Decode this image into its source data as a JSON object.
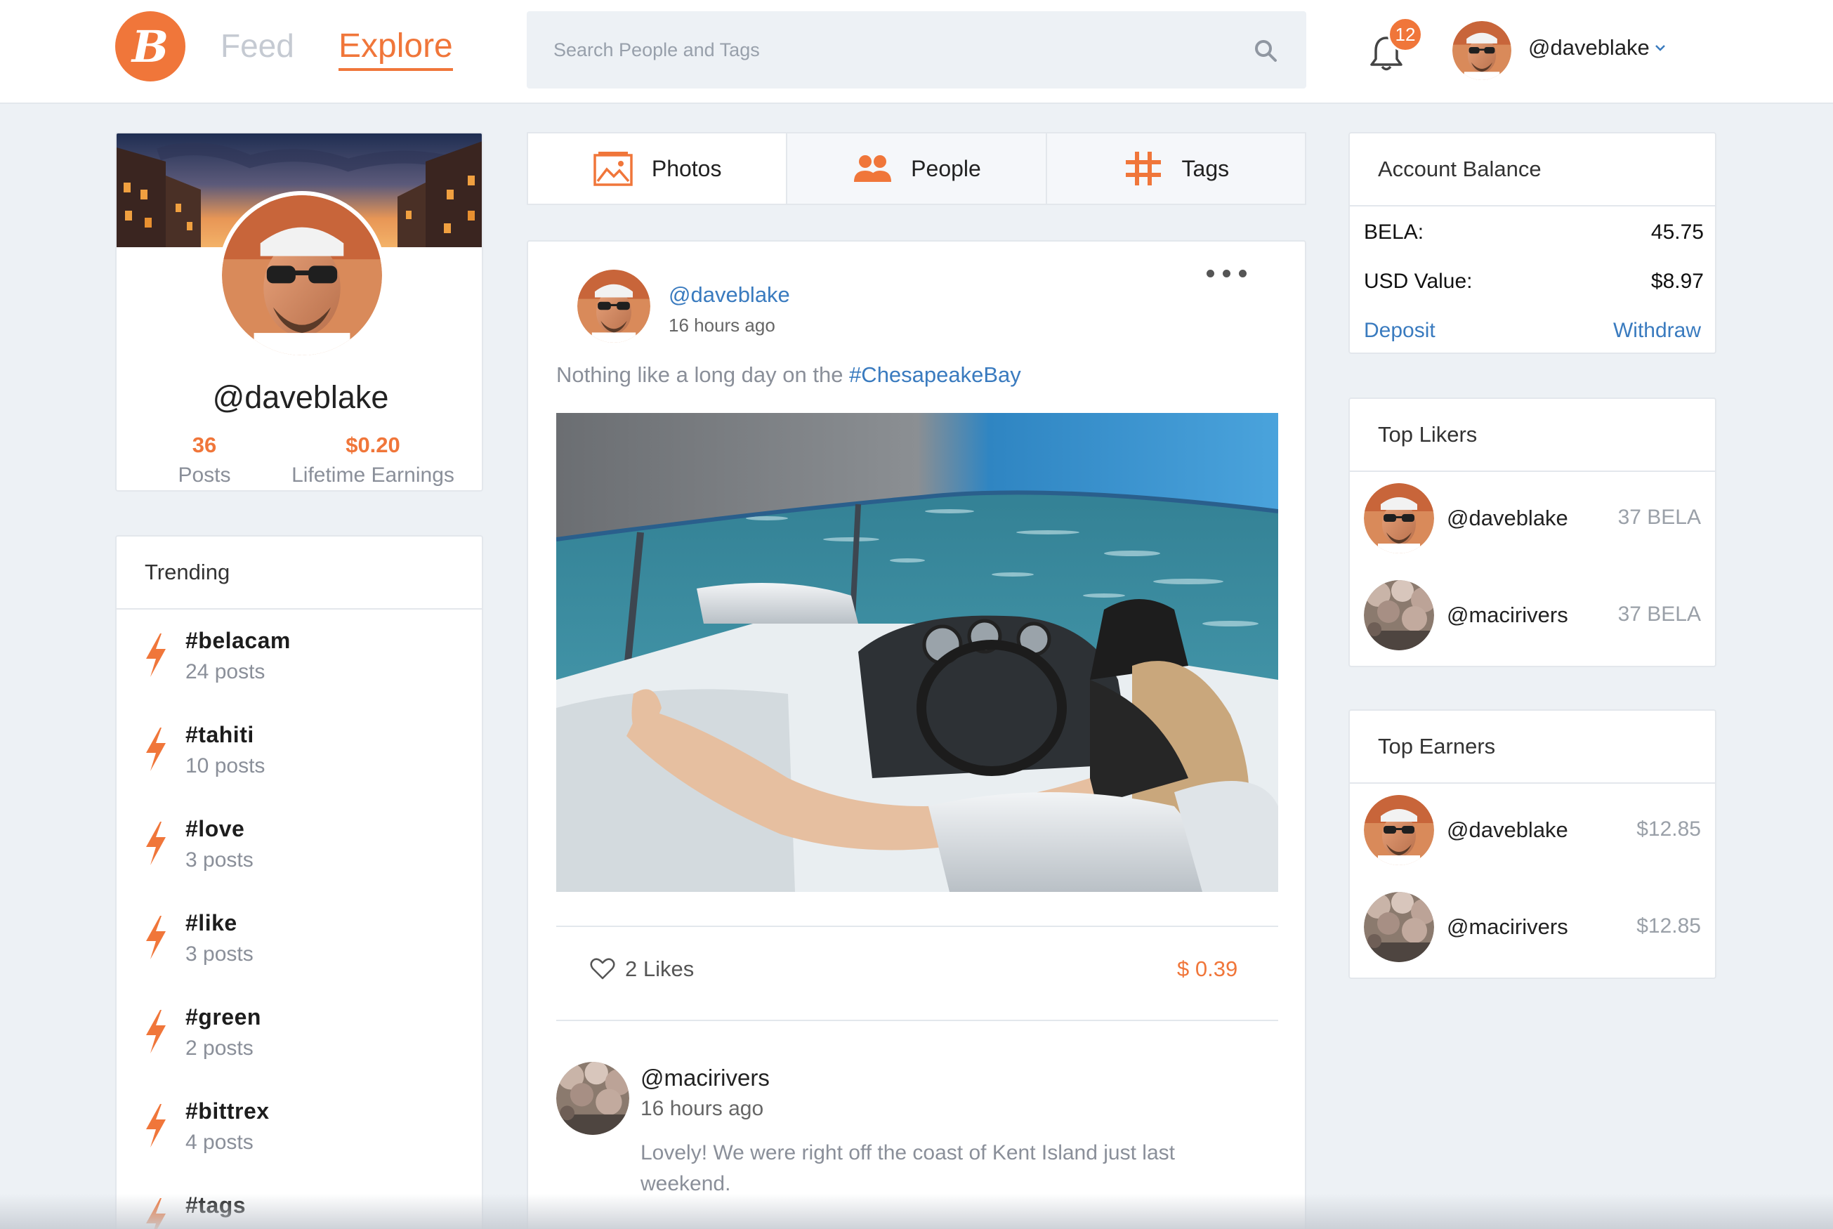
{
  "header": {
    "logo_letter": "B",
    "nav_feed": "Feed",
    "nav_explore": "Explore",
    "search_placeholder": "Search People and Tags",
    "notification_count": "12",
    "username": "@daveblake"
  },
  "profile": {
    "username": "@daveblake",
    "posts_count": "36",
    "posts_label": "Posts",
    "earnings": "$0.20",
    "earnings_label": "Lifetime Earnings"
  },
  "trending": {
    "title": "Trending",
    "items": [
      {
        "tag": "#belacam",
        "count": "24 posts"
      },
      {
        "tag": "#tahiti",
        "count": "10 posts"
      },
      {
        "tag": "#love",
        "count": "3 posts"
      },
      {
        "tag": "#like",
        "count": "3 posts"
      },
      {
        "tag": "#green",
        "count": "2 posts"
      },
      {
        "tag": "#bittrex",
        "count": "4 posts"
      },
      {
        "tag": "#tags",
        "count": ""
      }
    ]
  },
  "tabs": [
    {
      "label": "Photos"
    },
    {
      "label": "People"
    },
    {
      "label": "Tags"
    }
  ],
  "post": {
    "username": "@daveblake",
    "time": "16 hours ago",
    "caption_text": "Nothing like a long day on the ",
    "caption_tag": "#ChesapeakeBay",
    "likes": "2 Likes",
    "earnings": "$ 0.39",
    "comment": {
      "username": "@macirivers",
      "time": "16 hours ago",
      "text": "Lovely! We were right off the coast of Kent Island just last weekend."
    }
  },
  "balance": {
    "title": "Account Balance",
    "bela_label": "BELA:",
    "bela_value": "45.75",
    "usd_label": "USD Value:",
    "usd_value": "$8.97",
    "deposit": "Deposit",
    "withdraw": "Withdraw"
  },
  "top_likers": {
    "title": "Top Likers",
    "items": [
      {
        "name": "@daveblake",
        "value": "37 BELA"
      },
      {
        "name": "@macirivers",
        "value": "37 BELA"
      }
    ]
  },
  "top_earners": {
    "title": "Top Earners",
    "items": [
      {
        "name": "@daveblake",
        "value": "$12.85"
      },
      {
        "name": "@macirivers",
        "value": "$12.85"
      }
    ]
  },
  "colors": {
    "accent": "#f0763a",
    "link": "#3a7bbf",
    "background": "#edf1f5"
  }
}
